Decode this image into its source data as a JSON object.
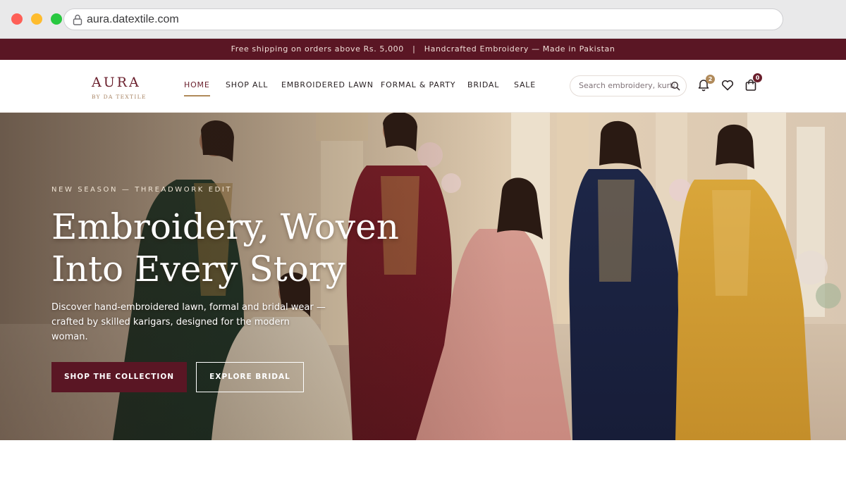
{
  "browser": {
    "url": "aura.datextile.com",
    "lock_icon": "lock-icon"
  },
  "announcement": {
    "text": "Free shipping on orders above Rs. 5,000   |   Handcrafted Embroidery — Made in Pakistan"
  },
  "brand": {
    "name": "AURA",
    "tagline": "BY DA TEXTILE",
    "primary_color": "#5a1624",
    "accent_color": "#b08a5a"
  },
  "nav": {
    "items": [
      {
        "label": "HOME",
        "active": true
      },
      {
        "label": "SHOP ALL",
        "active": false
      },
      {
        "label": "EMBROIDERED LAWN",
        "active": false
      },
      {
        "label": "FORMAL & PARTY",
        "active": false
      },
      {
        "label": "BRIDAL",
        "active": false
      },
      {
        "label": "SALE",
        "active": false
      }
    ],
    "search_placeholder": "Search embroidery, kurta...",
    "notifications_count": "2",
    "cart_count": "0",
    "icons": [
      "search-icon",
      "bell-icon",
      "heart-icon",
      "bag-icon"
    ]
  },
  "hero": {
    "eyebrow": "NEW SEASON — THREADWORK EDIT",
    "title_line1": "Embroidery, Woven",
    "title_line2": "Into Every Story",
    "description": "Discover hand-embroidered lawn, formal and bridal wear — crafted by skilled karigars, designed for the modern woman.",
    "primary_cta": "SHOP THE COLLECTION",
    "secondary_cta": "EXPLORE BRIDAL"
  }
}
